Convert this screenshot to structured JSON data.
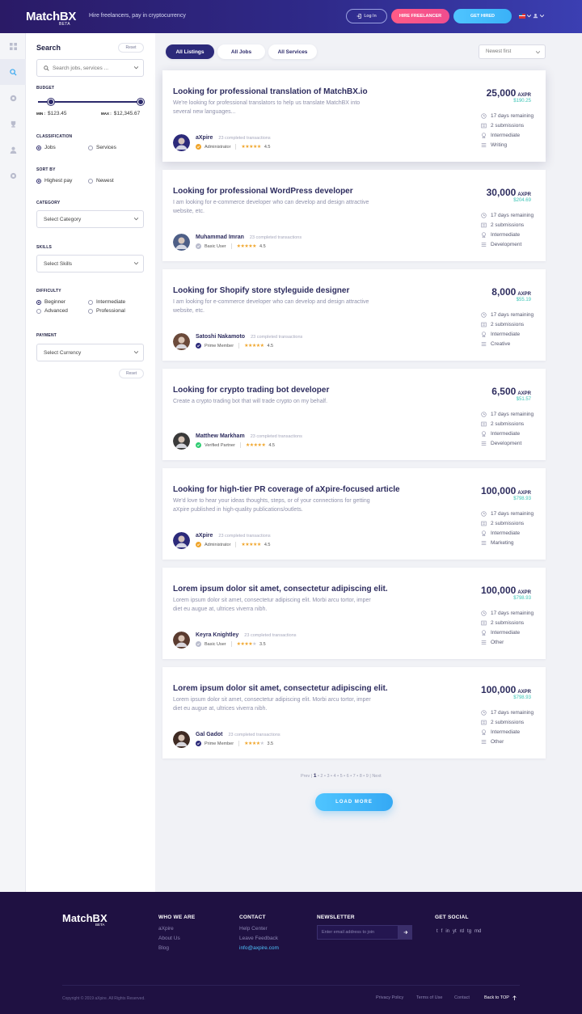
{
  "header": {
    "logo": "MatchBX",
    "logo_beta": "BETA",
    "tagline": "Hire freelancers, pay in cryptocurrency",
    "login_label": "Log In",
    "hire_label": "HIRE FREELANCER",
    "gethired_label": "GET HIRED"
  },
  "rail": {
    "icons": [
      "dashboard-icon",
      "search-icon",
      "coin-icon",
      "trophy-icon",
      "user-icon",
      "settings-icon"
    ],
    "active_index": 1
  },
  "filters": {
    "title": "Search",
    "reset_top": "Reset",
    "search_placeholder": "Search jobs, services ...",
    "budget_label": "BUDGET",
    "min_label": "MIN :",
    "min_value": "$123.45",
    "max_label": "MAX :",
    "max_value": "$12,345.67",
    "classification_label": "CLASSIFICATION",
    "classification_options": [
      "Jobs",
      "Services"
    ],
    "sortby_label": "SORT BY",
    "sortby_options": [
      "Highest pay",
      "Newest"
    ],
    "category_label": "CATEGORY",
    "category_value": "Select Category",
    "skills_label": "SKILLS",
    "skills_value": "Select Skills",
    "difficulty_label": "DIFFICULTY",
    "difficulty_options": [
      "Beginner",
      "Intermediate",
      "Advanced",
      "Professional"
    ],
    "payment_label": "PAYMENT",
    "payment_value": "Select Currency",
    "reset_bottom": "Reset"
  },
  "tabs": [
    "All Listings",
    "All Jobs",
    "All Services"
  ],
  "sort_value": "Newest first",
  "listings": [
    {
      "title": "Looking for professional translation of MatchBX.io",
      "desc": "We're looking for professional translators to help us translate MatchBX into several new languages...",
      "name": "aXpire",
      "trans": "23 completed transactions",
      "role": "Administrator",
      "rating": "4.5",
      "stars": 5,
      "amount": "25,000",
      "currency": "AXPR",
      "usd": "$190.25",
      "days": "17 days remaining",
      "subs": "2 submissions",
      "level": "Intermediate",
      "cat": "Writing"
    },
    {
      "title": "Looking for professional WordPress developer",
      "desc": "I am looking for e-commerce developer who can develop and design attractive website, etc.",
      "name": "Muhammad Imran",
      "trans": "23 completed transactions",
      "role": "Basic User",
      "rating": "4.5",
      "stars": 5,
      "amount": "30,000",
      "currency": "AXPR",
      "usd": "$204.69",
      "days": "17 days remaining",
      "subs": "2 submissions",
      "level": "Intermediate",
      "cat": "Development"
    },
    {
      "title": "Looking for Shopify store styleguide designer",
      "desc": "I am looking for e-commerce developer who can develop and design attractive website, etc.",
      "name": "Satoshi Nakamoto",
      "trans": "23 completed transactions",
      "role": "Prime Member",
      "rating": "4.5",
      "stars": 5,
      "amount": "8,000",
      "currency": "AXPR",
      "usd": "$55.19",
      "days": "17 days remaining",
      "subs": "2 submissions",
      "level": "Intermediate",
      "cat": "Creative"
    },
    {
      "title": "Looking for crypto trading bot developer",
      "desc": "Create a crypto trading bot that will trade crypto on my behalf.",
      "name": "Matthew Markham",
      "trans": "23 completed transactions",
      "role": "Verified Partner",
      "rating": "4.5",
      "stars": 5,
      "amount": "6,500",
      "currency": "AXPR",
      "usd": "$51.57",
      "days": "17 days remaining",
      "subs": "2 submissions",
      "level": "Intermediate",
      "cat": "Development"
    },
    {
      "title": "Looking for high-tier PR coverage of aXpire-focused article",
      "desc": "We'd love to hear your ideas thoughts, steps, or of your connections for getting aXpire published in high-quality publications/outlets.",
      "name": "aXpire",
      "trans": "23 completed transactions",
      "role": "Administrator",
      "rating": "4.5",
      "stars": 5,
      "amount": "100,000",
      "currency": "AXPR",
      "usd": "$798.93",
      "days": "17 days remaining",
      "subs": "2 submissions",
      "level": "Intermediate",
      "cat": "Marketing"
    },
    {
      "title": "Lorem ipsum dolor sit amet, consectetur adipiscing elit.",
      "desc": "Lorem ipsum dolor sit amet, consectetur adipiscing elit. Morbi arcu tortor, imper diet eu augue at, ultrices viverra nibh.",
      "name": "Keyra Knightley",
      "trans": "23 completed transactions",
      "role": "Basic User",
      "rating": "3.5",
      "stars": 4,
      "amount": "100,000",
      "currency": "AXPR",
      "usd": "$798.93",
      "days": "17 days remaining",
      "subs": "2 submissions",
      "level": "Intermediate",
      "cat": "Other"
    },
    {
      "title": "Lorem ipsum dolor sit amet, consectetur adipiscing elit.",
      "desc": "Lorem ipsum dolor sit amet, consectetur adipiscing elit. Morbi arcu tortor, imper diet eu augue at, ultrices viverra nibh.",
      "name": "Gal Gadot",
      "trans": "23 completed transactions",
      "role": "Prime Member",
      "rating": "3.5",
      "stars": 4,
      "amount": "100,000",
      "currency": "AXPR",
      "usd": "$798.93",
      "days": "17 days remaining",
      "subs": "2 submissions",
      "level": "Intermediate",
      "cat": "Other"
    }
  ],
  "pagination": {
    "prev": "Prev",
    "pages": [
      "1",
      "2",
      "3",
      "4",
      "5",
      "6",
      "7",
      "8",
      "9"
    ],
    "current": "1",
    "next": "Next"
  },
  "load_more": "LOAD MORE",
  "footer": {
    "logo": "MatchBX",
    "logo_beta": "BETA",
    "who_title": "WHO WE ARE",
    "who_links": [
      "aXpire",
      "About Us",
      "Blog"
    ],
    "contact_title": "CONTACT",
    "contact_links": [
      "Help Center",
      "Leave Feedback"
    ],
    "contact_email": "info@axpire.com",
    "newsletter_title": "NEWSLETTER",
    "newsletter_placeholder": "Enter email address to join",
    "social_title": "GET SOCIAL",
    "social_glyphs": [
      "t",
      "f",
      "in",
      "yt",
      "rd",
      "tg",
      "md"
    ],
    "copyright": "Copyright © 2019 aXpire. All Rights Reserved.",
    "privacy": "Privacy Policy",
    "terms": "Terms of Use",
    "contact": "Contact",
    "back_to_top": "Back to TOP"
  },
  "colors": {
    "primary": "#2c2a7a",
    "accent_pink": "#ff5b86",
    "accent_blue": "#4fc5ff",
    "usd_green": "#3cc4b6",
    "star": "#f0a52b",
    "footer_bg": "#1f1142"
  }
}
